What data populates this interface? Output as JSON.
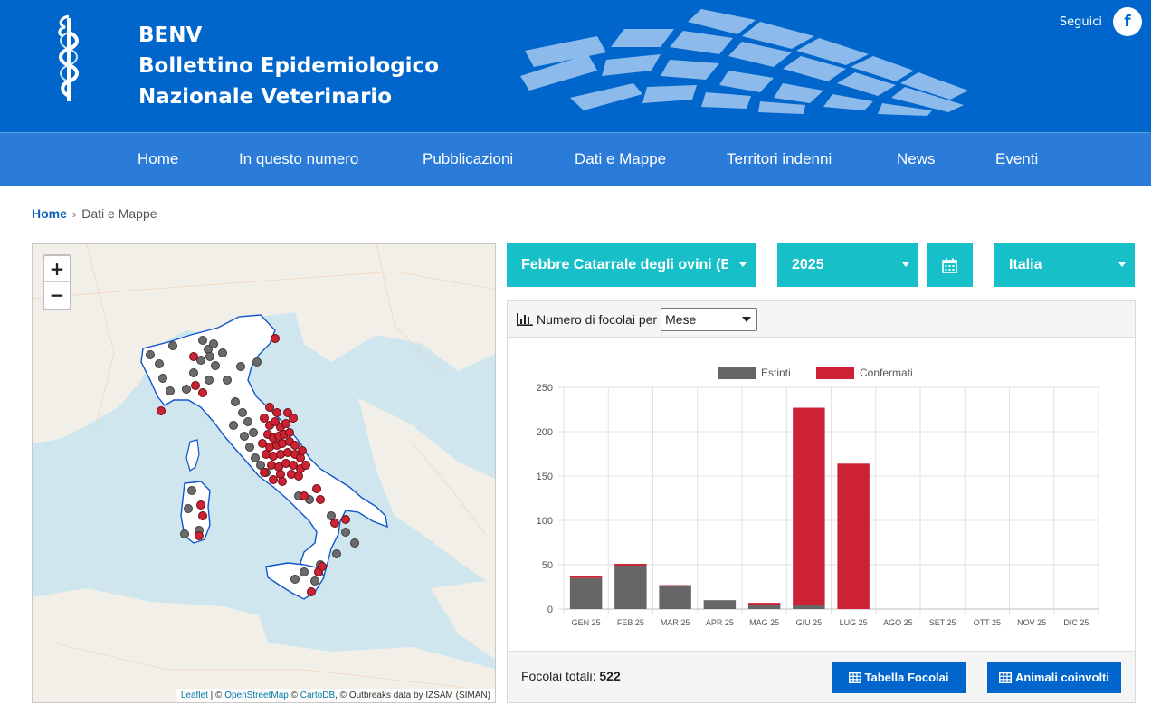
{
  "header": {
    "brand_short": "BENV",
    "brand_line1": "Bollettino Epidemiologico",
    "brand_line2": "Nazionale Veterinario",
    "follow_label": "Seguici",
    "facebook_glyph": "f"
  },
  "nav": {
    "items": [
      "Home",
      "In questo numero",
      "Pubblicazioni",
      "Dati e Mappe",
      "Territori indenni",
      "News",
      "Eventi"
    ]
  },
  "breadcrumb": {
    "home": "Home",
    "separator": "›",
    "current": "Dati e Mappe"
  },
  "map": {
    "zoom_in": "+",
    "zoom_out": "−",
    "attribution": {
      "leaflet": "Leaflet",
      "sep1": " | © ",
      "osm": "OpenStreetMap",
      "sep2": " © ",
      "carto": "CartoDB",
      "rest": ", © Outbreaks data by IZSAM (SIMAN)"
    }
  },
  "filters": {
    "disease": "Febbre Catarrale degli ovini (BT)",
    "year": "2025",
    "calendar_icon": "calendar-icon",
    "area": "Italia"
  },
  "panel": {
    "header_label": "Numero di focolai per",
    "period_select": "Mese",
    "total_label": "Focolai totali:",
    "total_value": "522",
    "btn_table": "Tabella Focolai",
    "btn_animals": "Animali coinvolti"
  },
  "colors": {
    "header_bg": "#0066cc",
    "nav_bg": "#2b7cd9",
    "filter_bg": "#17c0c8",
    "extinct": "#666666",
    "confirmed": "#cc2233"
  },
  "chart_data": {
    "type": "bar",
    "stacked": true,
    "categories": [
      "GEN 25",
      "FEB 25",
      "MAR 25",
      "APR 25",
      "MAG 25",
      "GIU 25",
      "LUG 25",
      "AGO 25",
      "SET 25",
      "OTT 25",
      "NOV 25",
      "DIC 25"
    ],
    "series": [
      {
        "name": "Estinti",
        "color": "#666666",
        "values": [
          35,
          49,
          26,
          10,
          5,
          5,
          0,
          0,
          0,
          0,
          0,
          0
        ]
      },
      {
        "name": "Confermati",
        "color": "#cc2233",
        "values": [
          2,
          2,
          1,
          0,
          2,
          222,
          164,
          0,
          0,
          0,
          0,
          0
        ]
      }
    ],
    "ylim": [
      0,
      250
    ],
    "yticks": [
      0,
      50,
      100,
      150,
      200,
      250
    ],
    "grid": true,
    "legend_position": "top-center"
  }
}
